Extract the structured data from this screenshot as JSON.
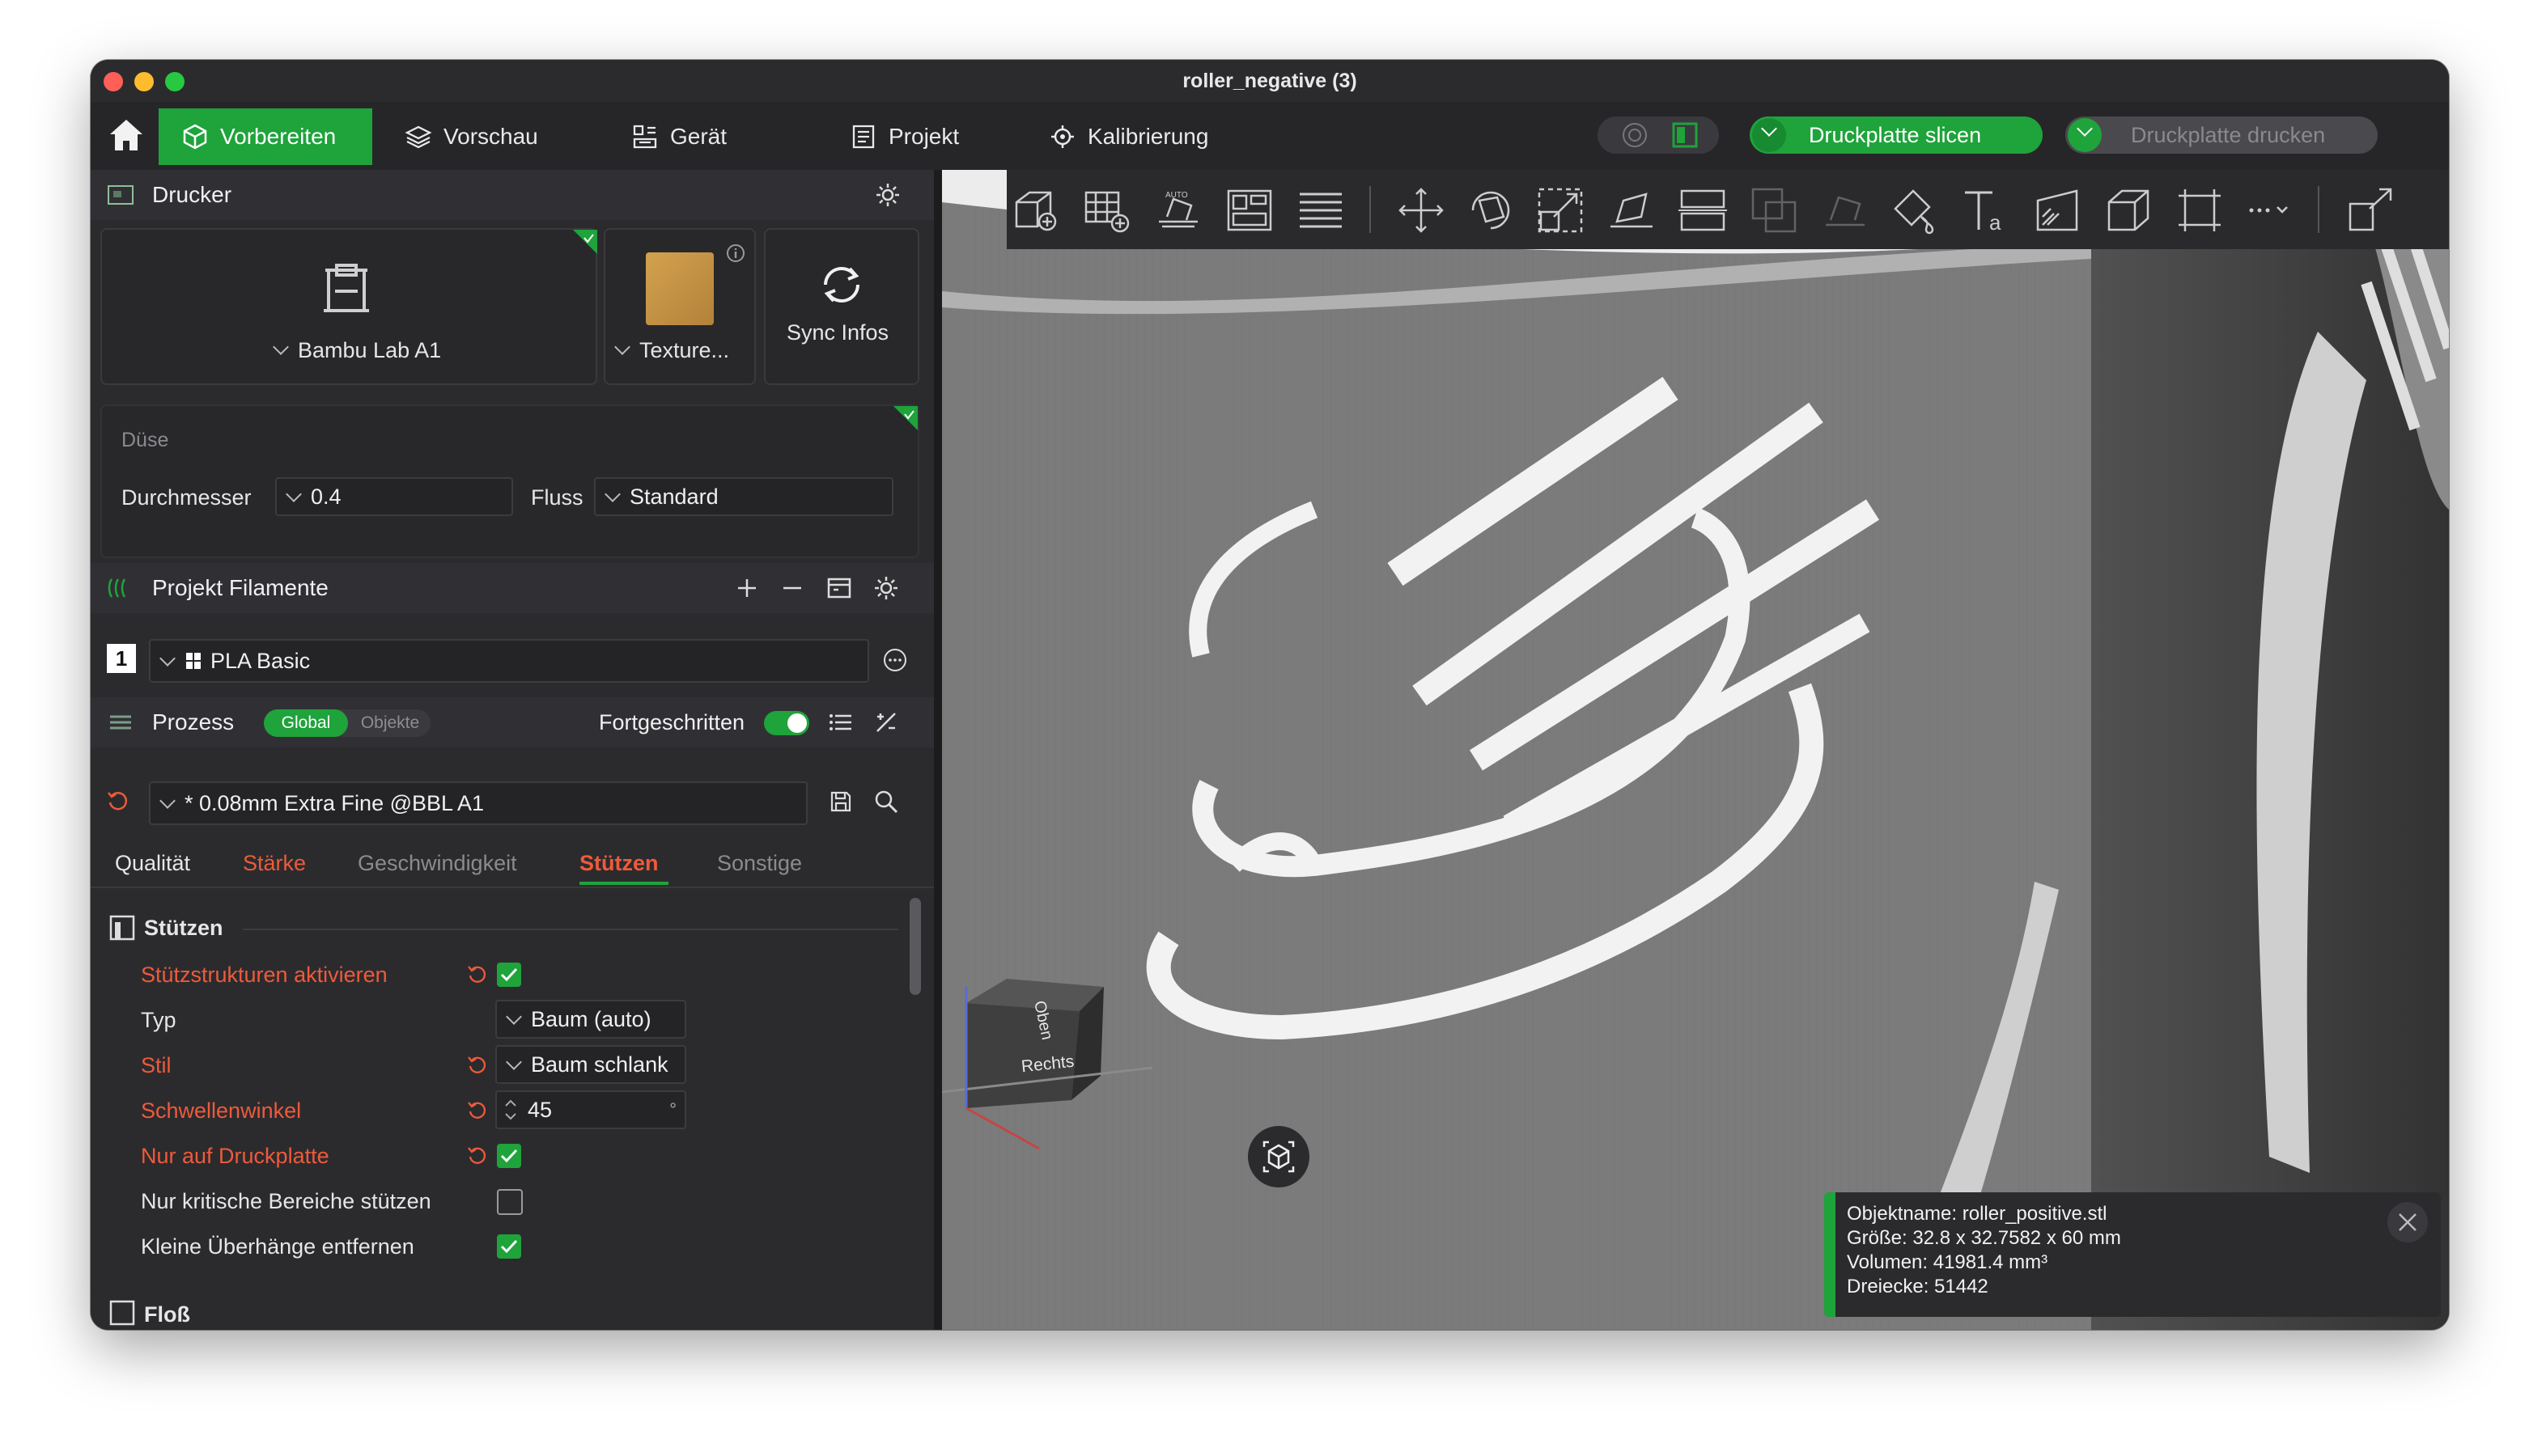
{
  "window": {
    "title": "roller_negative (3)"
  },
  "menu": {
    "tabs": [
      {
        "label": "Vorbereiten",
        "icon": "cube-icon",
        "active": true
      },
      {
        "label": "Vorschau",
        "icon": "layers-icon"
      },
      {
        "label": "Gerät",
        "icon": "device-icon"
      },
      {
        "label": "Projekt",
        "icon": "project-icon"
      },
      {
        "label": "Kalibrierung",
        "icon": "calibration-icon"
      }
    ],
    "slice_button": "Druckplatte slicen",
    "print_button": "Druckplatte drucken"
  },
  "printer": {
    "section_label": "Drucker",
    "model": "Bambu Lab A1",
    "plate": "Texture...",
    "sync_label": "Sync Infos"
  },
  "nozzle": {
    "title": "Düse",
    "diameter_label": "Durchmesser",
    "diameter_value": "0.4",
    "flow_label": "Fluss",
    "flow_value": "Standard"
  },
  "filaments": {
    "section_label": "Projekt Filamente",
    "items": [
      {
        "index": "1",
        "name": "PLA Basic"
      }
    ]
  },
  "process": {
    "section_label": "Prozess",
    "toggle_global": "Global",
    "toggle_objects": "Objekte",
    "advanced_label": "Fortgeschritten",
    "advanced_on": true,
    "preset": "* 0.08mm Extra Fine @BBL A1",
    "tabs": [
      {
        "label": "Qualität",
        "state": "normal"
      },
      {
        "label": "Stärke",
        "state": "modified"
      },
      {
        "label": "Geschwindigkeit",
        "state": "muted"
      },
      {
        "label": "Stützen",
        "state": "active"
      },
      {
        "label": "Sonstige",
        "state": "muted"
      }
    ]
  },
  "supports": {
    "group_title": "Stützen",
    "rows": [
      {
        "label": "Stützstrukturen aktivieren",
        "modified": true,
        "control": "checkbox",
        "checked": true,
        "reset": true
      },
      {
        "label": "Typ",
        "modified": false,
        "control": "dropdown",
        "value": "Baum (auto)"
      },
      {
        "label": "Stil",
        "modified": true,
        "control": "dropdown",
        "value": "Baum schlank",
        "reset": true
      },
      {
        "label": "Schwellenwinkel",
        "modified": true,
        "control": "spin",
        "value": "45",
        "unit": "°",
        "reset": true
      },
      {
        "label": "Nur auf Druckplatte",
        "modified": true,
        "control": "checkbox",
        "checked": true,
        "reset": true
      },
      {
        "label": "Nur kritische Bereiche stützen",
        "modified": false,
        "control": "checkbox",
        "checked": false
      },
      {
        "label": "Kleine Überhänge entfernen",
        "modified": false,
        "control": "checkbox",
        "checked": true
      }
    ],
    "next_group": "Floß"
  },
  "viewport": {
    "cube_top": "Oben",
    "cube_right": "Rechts",
    "info": {
      "object_name": "Objektname: roller_positive.stl",
      "size": "Größe: 32.8 x 32.7582 x 60 mm",
      "volume": "Volumen: 41981.4 mm³",
      "triangles": "Dreiecke: 51442"
    }
  },
  "colors": {
    "accent": "#1fa33b",
    "modified": "#ef5a3a",
    "panel": "#2b2b2e"
  }
}
